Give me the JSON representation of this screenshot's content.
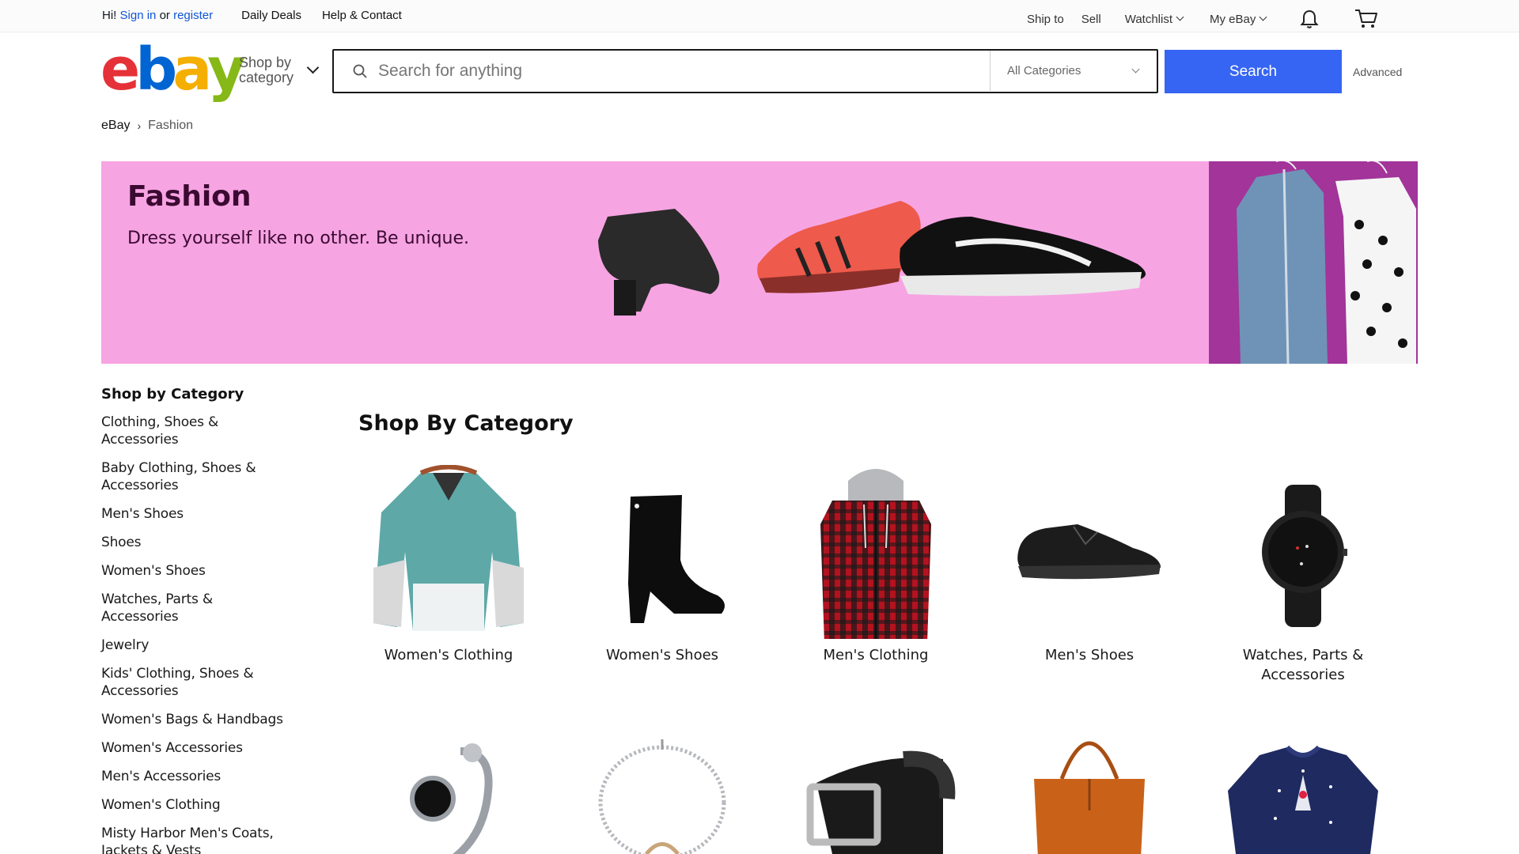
{
  "topbar": {
    "greeting": "Hi!",
    "sign_in": "Sign in",
    "or": "or",
    "register": "register",
    "daily_deals": "Daily Deals",
    "help_contact": "Help & Contact",
    "ship_to": "Ship to",
    "sell": "Sell",
    "watchlist": "Watchlist",
    "my_ebay": "My eBay"
  },
  "header": {
    "logo_letters": [
      "e",
      "b",
      "a",
      "y"
    ],
    "logo_colors": [
      "#e53238",
      "#0064d2",
      "#f5af02",
      "#86b817"
    ],
    "shop_by_category_line1": "Shop by",
    "shop_by_category_line2": "category",
    "search_placeholder": "Search for anything",
    "category_select": "All Categories",
    "search_button": "Search",
    "advanced": "Advanced"
  },
  "breadcrumb": {
    "root": "eBay",
    "current": "Fashion"
  },
  "hero": {
    "title": "Fashion",
    "subtitle": "Dress yourself like no other. Be unique."
  },
  "sidebar": {
    "heading": "Shop by Category",
    "items": [
      "Clothing, Shoes & Accessories",
      "Baby Clothing, Shoes & Accessories",
      "Men's Shoes",
      "Shoes",
      "Women's Shoes",
      "Watches, Parts & Accessories",
      "Jewelry",
      "Kids' Clothing, Shoes & Accessories",
      "Women's Bags & Handbags",
      "Women's Accessories",
      "Men's Accessories",
      "Women's Clothing",
      "Misty Harbor Men's Coats, Jackets & Vests"
    ]
  },
  "main": {
    "title": "Shop By Category",
    "categories": [
      "Women's Clothing",
      "Women's Shoes",
      "Men's Clothing",
      "Men's Shoes",
      "Watches, Parts & Accessories"
    ]
  },
  "colors": {
    "accent_blue": "#3665f3",
    "link_blue": "#1155d4",
    "hero_pink": "#f7a4e3",
    "hero_text": "#3b0a31"
  }
}
